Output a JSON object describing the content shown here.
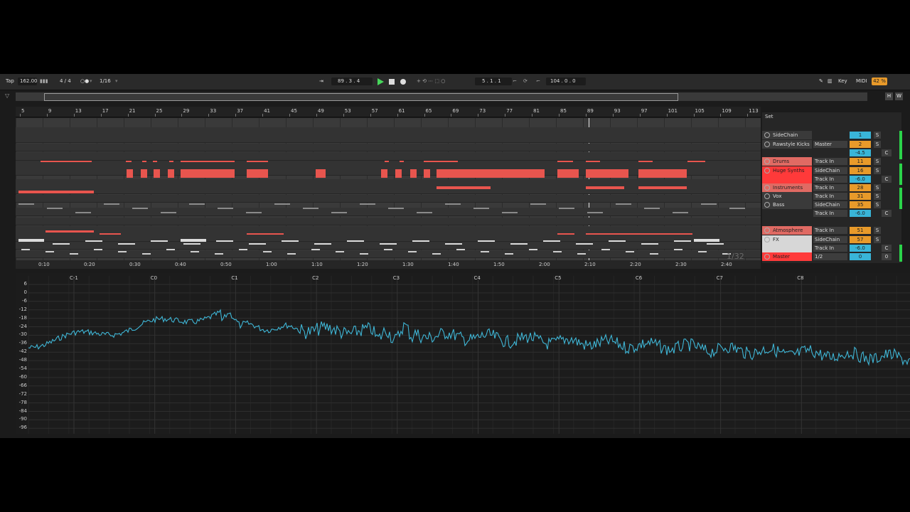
{
  "transport": {
    "tap": "Tap",
    "tempo": "162.00",
    "signature": "4 / 4",
    "quantize": "1/16",
    "position": "89 .  3 .  4",
    "loop_start": "5 .  1 .  1",
    "loop_length": "104 .  0 .  0",
    "key": "Key",
    "midi": "MIDI",
    "cpu": "42 %",
    "h": "H",
    "w": "W"
  },
  "ruler": {
    "bars": [
      "5",
      "9",
      "13",
      "17",
      "21",
      "25",
      "29",
      "33",
      "37",
      "41",
      "45",
      "49",
      "53",
      "57",
      "61",
      "65",
      "69",
      "73",
      "77",
      "81",
      "85",
      "89",
      "93",
      "97",
      "101",
      "105",
      "109",
      "113"
    ]
  },
  "time_ruler": {
    "times": [
      "0:10",
      "0:20",
      "0:30",
      "0:40",
      "0:50",
      "1:00",
      "1:10",
      "1:20",
      "1:30",
      "1:40",
      "1:50",
      "2:00",
      "2:10",
      "2:20",
      "2:30",
      "2:40"
    ],
    "quantization": "1/32"
  },
  "mixer": {
    "set_label": "Set",
    "tracks": [
      {
        "name": "SideChain",
        "route": "",
        "value": "1",
        "value_color": "#39b5d8",
        "style": "dark",
        "s": "S",
        "c": ""
      },
      {
        "name": "Rawstyle Kicks",
        "route": "Master",
        "value": "2",
        "value_color": "#e89a2a",
        "style": "dark",
        "s": "S",
        "c": ""
      },
      {
        "name": "",
        "route": "",
        "value": "-4.5",
        "value_color": "#39b5d8",
        "style": "blank",
        "s": "",
        "c": "C"
      },
      {
        "name": "Drums",
        "route": "Track In",
        "value": "11",
        "value_color": "#e89a2a",
        "style": "red",
        "s": "S",
        "c": ""
      },
      {
        "name": "Huge Synths",
        "route": "SideChain",
        "value": "16",
        "value_color": "#e89a2a",
        "style": "bright",
        "s": "S",
        "c": ""
      },
      {
        "name": "",
        "route": "Track In",
        "value": "-6.0",
        "value_color": "#39b5d8",
        "style": "bright-blank",
        "s": "",
        "c": "C"
      },
      {
        "name": "Instruments",
        "route": "Track In",
        "value": "28",
        "value_color": "#e89a2a",
        "style": "red",
        "s": "S",
        "c": ""
      },
      {
        "name": "Vox",
        "route": "Track In",
        "value": "31",
        "value_color": "#e89a2a",
        "style": "dark",
        "s": "S",
        "c": ""
      },
      {
        "name": "Bass",
        "route": "SideChain",
        "value": "35",
        "value_color": "#e89a2a",
        "style": "dark",
        "s": "S",
        "c": ""
      },
      {
        "name": "",
        "route": "Track In",
        "value": "-6.0",
        "value_color": "#39b5d8",
        "style": "blank",
        "s": "",
        "c": "C"
      },
      {
        "name": "Atmosphere",
        "route": "Track In",
        "value": "51",
        "value_color": "#e89a2a",
        "style": "red",
        "s": "S",
        "c": ""
      },
      {
        "name": "FX",
        "route": "SideChain",
        "value": "57",
        "value_color": "#e89a2a",
        "style": "light",
        "s": "S",
        "c": ""
      },
      {
        "name": "",
        "route": "Track In",
        "value": "-6.0",
        "value_color": "#39b5d8",
        "style": "light-blank",
        "s": "",
        "c": "C"
      },
      {
        "name": "Master",
        "route": "1/2",
        "value": "0",
        "value_color": "#39b5d8",
        "style": "bright",
        "s": "",
        "c": "0"
      }
    ]
  },
  "spectrum": {
    "notes": [
      "C-1",
      "C0",
      "C1",
      "C2",
      "C3",
      "C4",
      "C5",
      "C6",
      "C7",
      "C8"
    ],
    "db_labels": [
      "6",
      "0",
      "-6",
      "-12",
      "-18",
      "-24",
      "-30",
      "-36",
      "-42",
      "-48",
      "-54",
      "-60",
      "-66",
      "-72",
      "-78",
      "-84",
      "-90",
      "-96"
    ],
    "line_color": "#3fb6d6"
  },
  "colors": {
    "clip_red": "#e8554e",
    "clip_grey": "#8a8a8a",
    "playhead": "#e8e8e8"
  }
}
